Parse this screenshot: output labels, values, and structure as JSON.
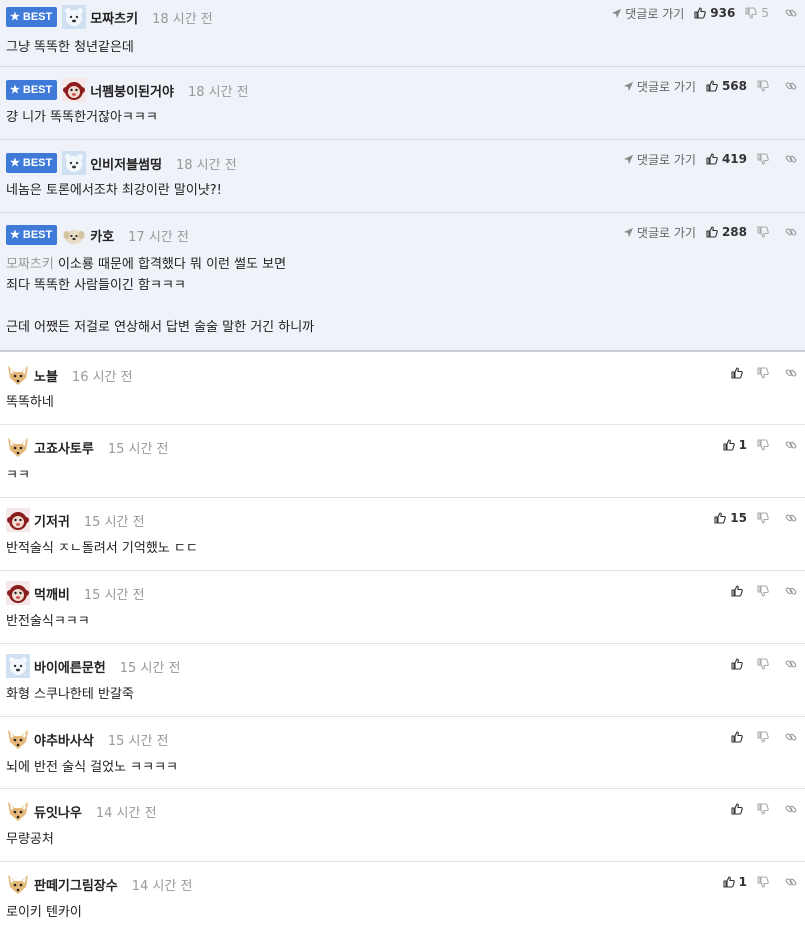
{
  "labels": {
    "best": "BEST",
    "goto_reply": "댓글로 가기"
  },
  "colors": {
    "best_badge": "#3f7ad9",
    "best_background": "#eff2f8",
    "mention": "#999999"
  },
  "best_comments": [
    {
      "nickname": "모짜츠키",
      "time": "18 시간 전",
      "up": "936",
      "down": "5",
      "text": "그냥 똑똑한 청년같은데",
      "avatar": "polar-bear-icon"
    },
    {
      "nickname": "너펨붕이된거야",
      "time": "18 시간 전",
      "up": "568",
      "down": "",
      "text": "걍 니가 똑똑한거잖아ㅋㅋㅋ",
      "avatar": "monkey-icon"
    },
    {
      "nickname": "인비저블썸띵",
      "time": "18 시간 전",
      "up": "419",
      "down": "",
      "text": "네놈은 토론에서조차 최강이란 말이냣?!",
      "avatar": "polar-bear-icon"
    },
    {
      "nickname": "카호",
      "time": "17 시간 전",
      "up": "288",
      "down": "",
      "mention": "모짜츠키",
      "text_first": " 이소룡 때문에 합격했다 뭐 이런 썰도 보면",
      "text_rest": "죄다 똑똑한 사람들이긴 함ㅋㅋㅋ\n\n근데 어쨌든 저걸로 연상해서 답변 술술 말한 거긴 하니까",
      "avatar": "puppy-icon"
    }
  ],
  "comments": [
    {
      "nickname": "노블",
      "time": "16 시간 전",
      "up": "",
      "text": "똑똑하네",
      "avatar": "fox-icon"
    },
    {
      "nickname": "고죠사토루",
      "time": "15 시간 전",
      "up": "1",
      "text": "ㅋㅋ",
      "avatar": "fox-icon"
    },
    {
      "nickname": "기저귀",
      "time": "15 시간 전",
      "up": "15",
      "text": "반적술식 ㅈㄴ돌려서 기억했노 ㄷㄷ",
      "avatar": "monkey-icon"
    },
    {
      "nickname": "먹깨비",
      "time": "15 시간 전",
      "up": "",
      "text": "반전술식ㅋㅋㅋ",
      "avatar": "monkey-icon"
    },
    {
      "nickname": "바이에른문헌",
      "time": "15 시간 전",
      "up": "",
      "text": "화형 스쿠나한테 반갈죽",
      "avatar": "polar-bear-icon"
    },
    {
      "nickname": "야추바사삭",
      "time": "15 시간 전",
      "up": "",
      "text": "뇌에 반전 술식 걸었노 ㅋㅋㅋㅋ",
      "avatar": "fox-icon"
    },
    {
      "nickname": "듀잇나우",
      "time": "14 시간 전",
      "up": "",
      "text": "무량공처",
      "avatar": "fox-icon"
    },
    {
      "nickname": "판떼기그림장수",
      "time": "14 시간 전",
      "up": "1",
      "text": "로이키 텐카이",
      "avatar": "fox-icon"
    }
  ]
}
